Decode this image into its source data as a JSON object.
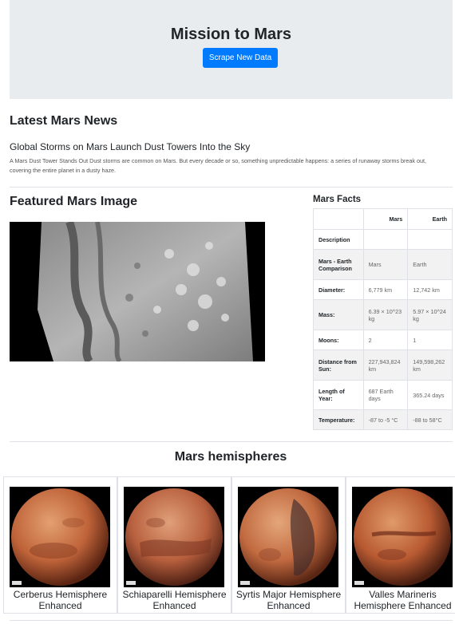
{
  "header": {
    "title": "Mission to Mars",
    "scrape_button": "Scrape New Data"
  },
  "news": {
    "heading": "Latest Mars News",
    "title": "Global Storms on Mars Launch Dust Towers Into the Sky",
    "body": "A Mars Dust Tower Stands Out Dust storms are common on Mars. But every decade or so, something unpredictable happens: a series of runaway storms break out, covering the entire planet in a dusty haze."
  },
  "featured": {
    "heading": "Featured Mars Image"
  },
  "facts": {
    "heading": "Mars Facts",
    "columns": [
      "Mars",
      "Earth"
    ],
    "rows": [
      {
        "label": "Description",
        "mars": "",
        "earth": ""
      },
      {
        "label": "Mars - Earth Comparison",
        "mars": "Mars",
        "earth": "Earth"
      },
      {
        "label": "Diameter:",
        "mars": "6,779 km",
        "earth": "12,742 km"
      },
      {
        "label": "Mass:",
        "mars": "6.39 × 10^23 kg",
        "earth": "5.97 × 10^24 kg"
      },
      {
        "label": "Moons:",
        "mars": "2",
        "earth": "1"
      },
      {
        "label": "Distance from Sun:",
        "mars": "227,943,824 km",
        "earth": "149,598,262 km"
      },
      {
        "label": "Length of Year:",
        "mars": "687 Earth days",
        "earth": "365.24 days"
      },
      {
        "label": "Temperature:",
        "mars": "-87 to -5 °C",
        "earth": "-88 to 58°C"
      }
    ]
  },
  "hemispheres": {
    "heading": "Mars hemispheres",
    "items": [
      {
        "title": "Cerberus Hemisphere Enhanced"
      },
      {
        "title": "Schiaparelli Hemisphere Enhanced"
      },
      {
        "title": "Syrtis Major Hemisphere Enhanced"
      },
      {
        "title": "Valles Marineris Hemisphere Enhanced"
      }
    ]
  },
  "colors": {
    "jumbotron_bg": "#e9ecef",
    "button": "#007bff",
    "mars_surface": "#c0643a"
  }
}
